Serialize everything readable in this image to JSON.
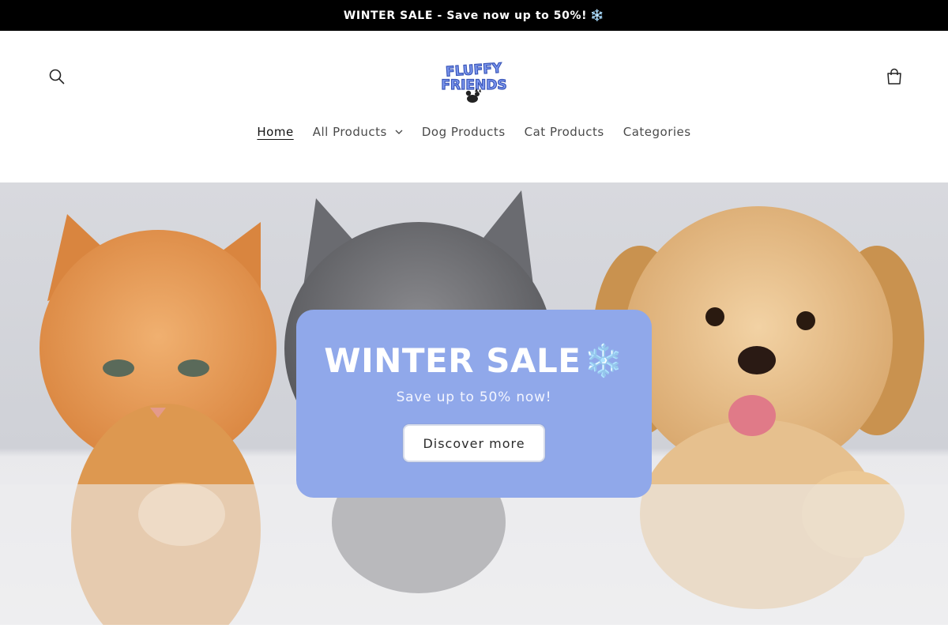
{
  "announcement": {
    "text": "WINTER SALE - Save now up to 50%!",
    "emoji": "❄️"
  },
  "header": {
    "logo_text_top": "FLUFFY",
    "logo_text_bottom": "FRIENDS",
    "search_icon": "search-icon",
    "cart_icon": "cart-icon"
  },
  "nav": {
    "items": [
      {
        "label": "Home",
        "active": true
      },
      {
        "label": "All Products",
        "has_dropdown": true
      },
      {
        "label": "Dog Products"
      },
      {
        "label": "Cat Products"
      },
      {
        "label": "Categories"
      }
    ]
  },
  "hero": {
    "title": "WINTER SALE",
    "title_emoji": "❄️",
    "subtitle": "Save up to 50% now!",
    "button_label": "Discover more"
  },
  "colors": {
    "promo_bg": "#90a8ea",
    "announcement_bg": "#000000",
    "logo_blue": "#6f8ff0"
  }
}
